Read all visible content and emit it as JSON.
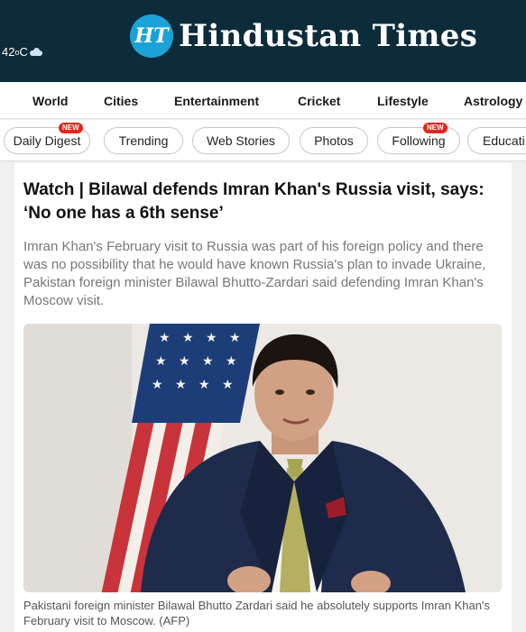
{
  "header": {
    "temperature": "42",
    "temp_unit": "C",
    "weather_icon": "cloud-sun-icon",
    "logo_badge": "HT",
    "logo_text": "Hindustan Times",
    "bg_color": "#0c2c3a",
    "badge_color": "#1ba3d8"
  },
  "nav": {
    "items": [
      "World",
      "Cities",
      "Entertainment",
      "Cricket",
      "Lifestyle",
      "Astrology"
    ]
  },
  "chips": {
    "items": [
      {
        "label": "Daily Digest",
        "badge": "NEW"
      },
      {
        "label": "Trending"
      },
      {
        "label": "Web Stories"
      },
      {
        "label": "Photos"
      },
      {
        "label": "Following",
        "badge": "NEW"
      },
      {
        "label": "Educati"
      }
    ]
  },
  "article": {
    "headline": "Watch | Bilawal defends Imran Khan's Russia visit, says: ‘No one has a 6th sense’",
    "summary": "Imran Khan's February visit to Russia was part of his foreign policy and there was no possibility that he would have known Russia's plan to invade Ukraine, Pakistan foreign minister Bilawal Bhutto-Zardari said defending Imran Khan's Moscow visit.",
    "caption": "Pakistani foreign minister Bilawal Bhutto Zardari said he absolutely supports Imran Khan's February visit to Moscow. (AFP)"
  }
}
